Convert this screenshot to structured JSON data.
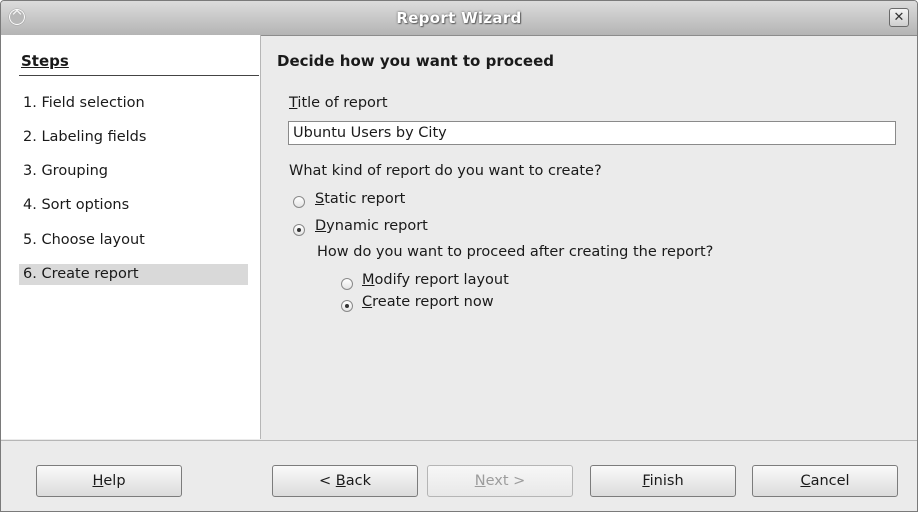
{
  "window": {
    "title": "Report Wizard"
  },
  "steps": {
    "title": "Steps",
    "items": [
      {
        "label": "1. Field selection"
      },
      {
        "label": "2. Labeling fields"
      },
      {
        "label": "3. Grouping"
      },
      {
        "label": "4. Sort options"
      },
      {
        "label": "5. Choose layout"
      },
      {
        "label": "6. Create report"
      }
    ],
    "active_index": 5
  },
  "main": {
    "heading": "Decide how you want to proceed",
    "title_label_mnemonic": "T",
    "title_label_rest": "itle of report",
    "title_value": "Ubuntu Users by City",
    "kind_question": "What kind of report do you want to create?",
    "static_mnemonic": "S",
    "static_rest": "tatic report",
    "static_selected": false,
    "dynamic_mnemonic": "D",
    "dynamic_rest": "ynamic report",
    "dynamic_selected": true,
    "proceed_question": "How do you want to proceed after creating the report?",
    "modify_mnemonic": "M",
    "modify_rest": "odify report layout",
    "modify_selected": false,
    "create_mnemonic": "C",
    "create_rest": "reate report now",
    "create_selected": true
  },
  "footer": {
    "help_mnemonic": "H",
    "help_rest": "elp",
    "back_prefix": "< ",
    "back_mnemonic": "B",
    "back_rest": "ack",
    "next_mnemonic": "N",
    "next_rest": "ext >",
    "finish_mnemonic": "F",
    "finish_rest": "inish",
    "cancel_mnemonic": "C",
    "cancel_rest": "ancel"
  }
}
